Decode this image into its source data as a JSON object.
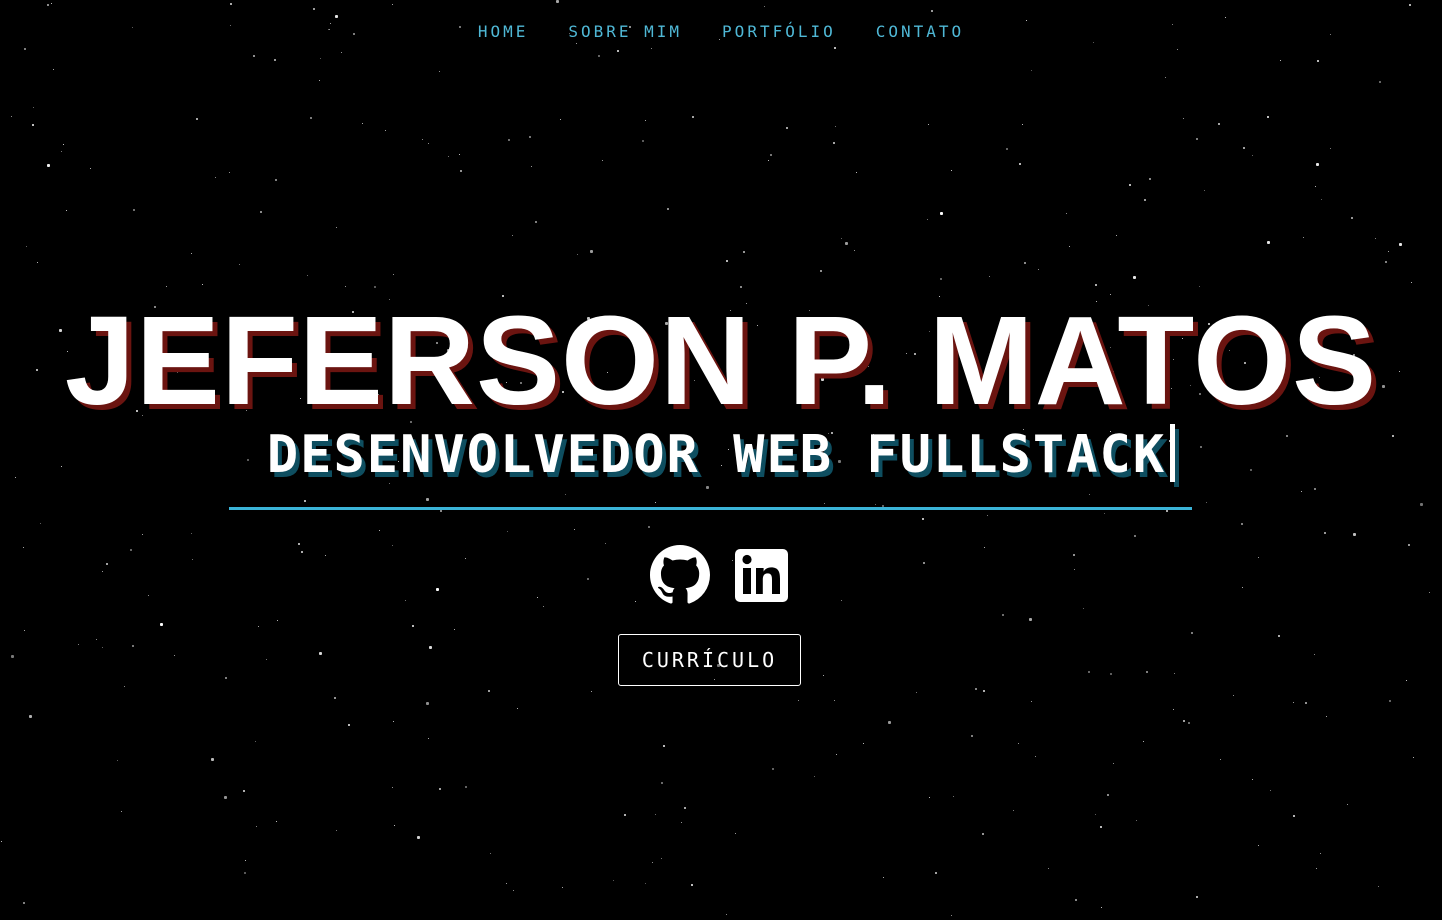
{
  "nav": {
    "items": [
      {
        "label": "HOME"
      },
      {
        "label": "SOBRE MIM"
      },
      {
        "label": "PORTFÓLIO"
      },
      {
        "label": "CONTATO"
      }
    ]
  },
  "hero": {
    "name": "JEFERSON P. MATOS",
    "subtitle": "DESENVOLVEDOR WEB FULLSTACK"
  },
  "social": {
    "items": [
      {
        "icon": "github-icon"
      },
      {
        "icon": "linkedin-icon"
      }
    ]
  },
  "cv_button": {
    "label": "CURRÍCULO"
  },
  "colors": {
    "background": "#000000",
    "accent": "#3bb4d8",
    "nav_text": "#4fb8d6",
    "title_shadow": "#6b1410",
    "subtitle_shadow": "#0e4e60",
    "text": "#ffffff"
  }
}
